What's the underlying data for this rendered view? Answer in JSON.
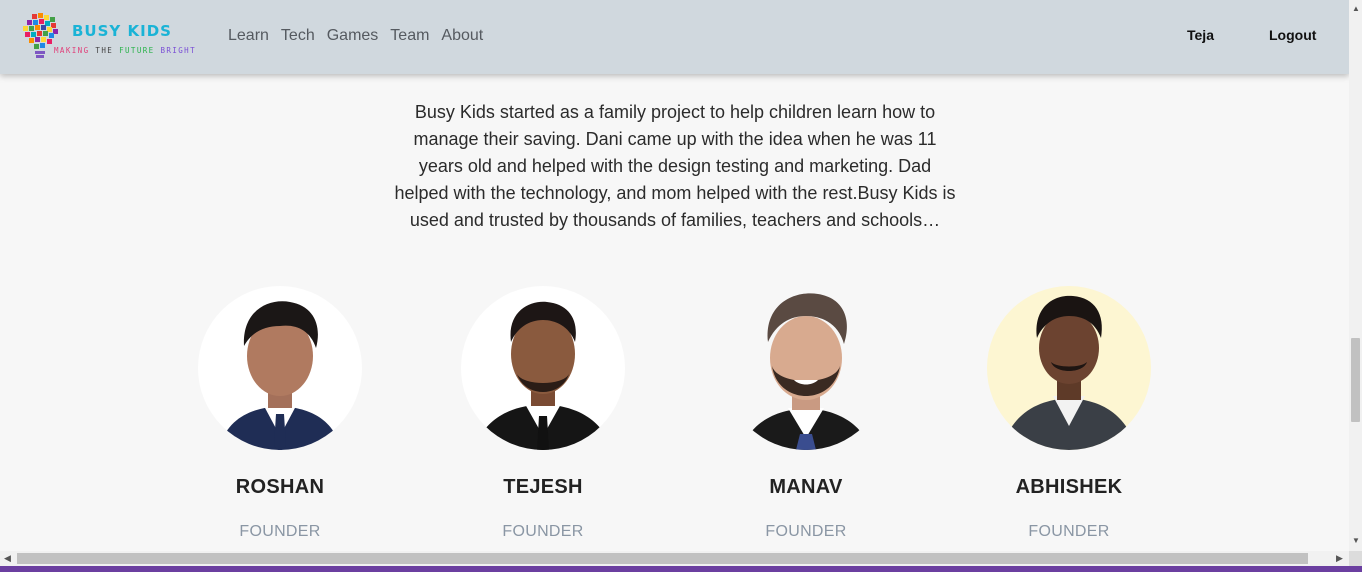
{
  "brand": {
    "title": "BUSY KIDS",
    "tagline_words": [
      "MAKING",
      "THE",
      "FUTURE",
      "BRIGHT"
    ]
  },
  "nav": {
    "links": [
      "Learn",
      "Tech",
      "Games",
      "Team",
      "About"
    ],
    "user_name": "Teja",
    "logout_label": "Logout"
  },
  "intro": {
    "text": "Busy Kids started as a family project to help children learn how to manage their saving. Dani came up with the idea when he was 11 years old and helped with the design testing and marketing. Dad helped with the technology, and mom helped with the rest.Busy Kids is used and trusted by thousands of families, teachers and schools…"
  },
  "team": [
    {
      "name": "ROSHAN",
      "role": "FOUNDER",
      "bg": "#ffffff",
      "suit": "#1f2d55",
      "tie": "#1f2d55"
    },
    {
      "name": "TEJESH",
      "role": "FOUNDER",
      "bg": "#ffffff",
      "suit": "#151515",
      "tie": "#111111"
    },
    {
      "name": "MANAV",
      "role": "FOUNDER",
      "bg": "#f7f7f7",
      "suit": "#1a1a1a",
      "tie": "#3a4d8f"
    },
    {
      "name": "ABHISHEK",
      "role": "FOUNDER",
      "bg": "#fdf6d2",
      "suit": "#3a3f46",
      "tie": ""
    }
  ],
  "colors": {
    "navbar_bg": "#d0d8de",
    "page_bg": "#f7f7f7",
    "role_text": "#8a96a4",
    "bottom_bar": "#6b3fa0"
  }
}
